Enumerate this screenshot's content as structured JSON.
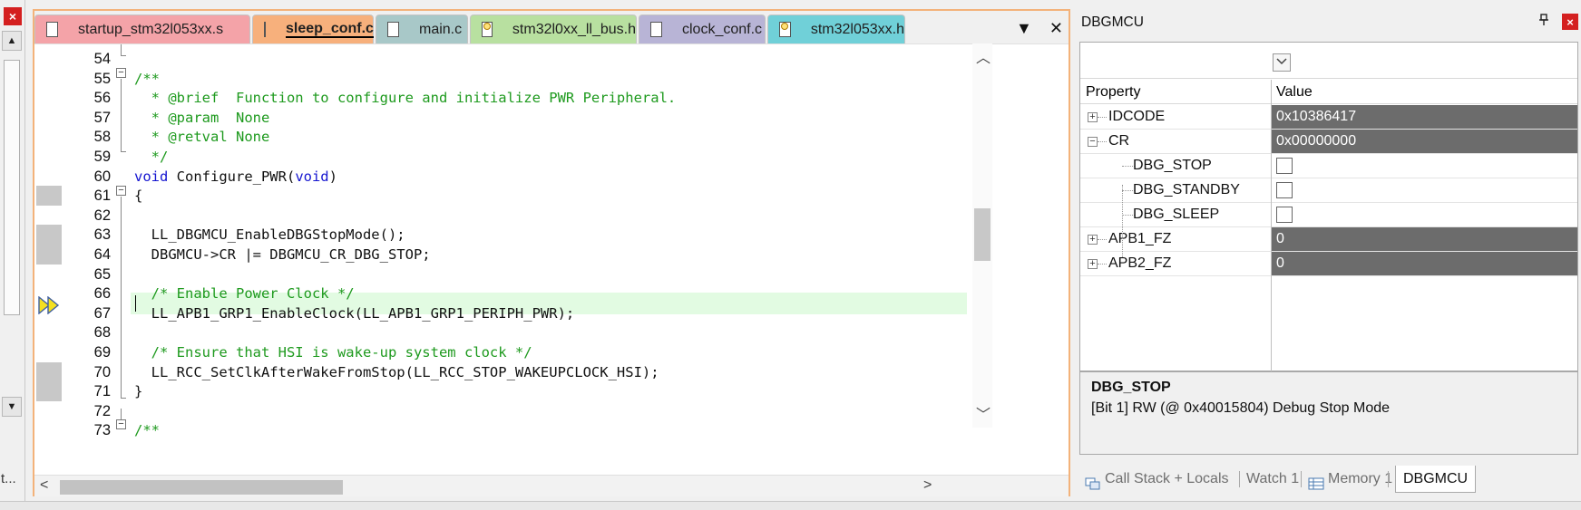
{
  "left_panel": {
    "close_glyph": "×",
    "up_arrow": "▲",
    "down_arrow": "▼",
    "truncated_label": "t..."
  },
  "editor": {
    "tabs": [
      {
        "label": "startup_stm32l053xx.s",
        "color": "#f4a3a8",
        "icon": "file-icon",
        "active": false
      },
      {
        "label": "sleep_conf.c",
        "color": "#f7b07c",
        "icon": "file-icon",
        "active": true
      },
      {
        "label": "main.c",
        "color": "#a8c8c8",
        "icon": "file-icon",
        "active": false
      },
      {
        "label": "stm32l0xx_ll_bus.h",
        "color": "#b8e0a0",
        "icon": "key-file-icon",
        "active": false
      },
      {
        "label": "clock_conf.c",
        "color": "#b8b4d6",
        "icon": "file-icon",
        "active": false
      },
      {
        "label": "stm32l053xx.h",
        "color": "#70d0d8",
        "icon": "key-file-icon",
        "active": false
      }
    ],
    "tab_menu_glyph": "▼",
    "tab_close_glyph": "✕",
    "current_line": 67,
    "lines": [
      {
        "num": "54",
        "text": "",
        "cls": "c-id"
      },
      {
        "num": "55",
        "text": "/**",
        "cls": "c-comment"
      },
      {
        "num": "56",
        "text": "  * @brief  Function to configure and initialize PWR Peripheral.",
        "cls": "c-comment"
      },
      {
        "num": "57",
        "text": "  * @param  None",
        "cls": "c-comment"
      },
      {
        "num": "58",
        "text": "  * @retval None",
        "cls": "c-comment"
      },
      {
        "num": "59",
        "text": "  */",
        "cls": "c-comment"
      },
      {
        "num": "60",
        "text": "",
        "cls": "c-id",
        "parts": [
          {
            "t": "void",
            "c": "c-kw"
          },
          {
            "t": " Configure_PWR(",
            "c": "c-id"
          },
          {
            "t": "void",
            "c": "c-kw"
          },
          {
            "t": ")",
            "c": "c-id"
          }
        ]
      },
      {
        "num": "61",
        "text": "{",
        "cls": "c-id"
      },
      {
        "num": "62",
        "text": "",
        "cls": "c-id"
      },
      {
        "num": "63",
        "text": "  LL_DBGMCU_EnableDBGStopMode();",
        "cls": "c-id"
      },
      {
        "num": "64",
        "text": "  DBGMCU->CR |= DBGMCU_CR_DBG_STOP;",
        "cls": "c-id"
      },
      {
        "num": "65",
        "text": "",
        "cls": "c-id"
      },
      {
        "num": "66",
        "text": "  /* Enable Power Clock */",
        "cls": "c-comment"
      },
      {
        "num": "67",
        "text": "  LL_APB1_GRP1_EnableClock(LL_APB1_GRP1_PERIPH_PWR);",
        "cls": "c-id"
      },
      {
        "num": "68",
        "text": "",
        "cls": "c-id"
      },
      {
        "num": "69",
        "text": "  /* Ensure that HSI is wake-up system clock */",
        "cls": "c-comment"
      },
      {
        "num": "70",
        "text": "  LL_RCC_SetClkAfterWakeFromStop(LL_RCC_STOP_WAKEUPCLOCK_HSI);",
        "cls": "c-id"
      },
      {
        "num": "71",
        "text": "}",
        "cls": "c-id"
      },
      {
        "num": "72",
        "text": "",
        "cls": "c-id"
      },
      {
        "num": "73",
        "text": "/**",
        "cls": "c-comment"
      }
    ],
    "breakpoint_lines": [
      "61",
      "63",
      "64",
      "70",
      "71"
    ]
  },
  "panel": {
    "title": "DBGMCU",
    "pin_glyph": "📌",
    "close_glyph": "×",
    "dropdown_glyph": "⌄",
    "header": {
      "property": "Property",
      "value": "Value"
    },
    "rows": [
      {
        "name": "IDCODE",
        "value": "0x10386417",
        "type": "expandable",
        "expanded": false
      },
      {
        "name": "CR",
        "value": "0x00000000",
        "type": "expandable",
        "expanded": true
      },
      {
        "name": "DBG_STOP",
        "value": "",
        "type": "checkbox",
        "checked": false
      },
      {
        "name": "DBG_STANDBY",
        "value": "",
        "type": "checkbox",
        "checked": false
      },
      {
        "name": "DBG_SLEEP",
        "value": "",
        "type": "checkbox",
        "checked": false
      },
      {
        "name": "APB1_FZ",
        "value": "0",
        "type": "expandable",
        "expanded": false
      },
      {
        "name": "APB2_FZ",
        "value": "0",
        "type": "expandable",
        "expanded": false
      }
    ],
    "description": {
      "title": "DBG_STOP",
      "text": "[Bit 1] RW (@ 0x40015804) Debug Stop Mode"
    },
    "bottom_tabs": [
      {
        "label": "Call Stack + Locals",
        "icon": "call-stack-icon",
        "active": false
      },
      {
        "label": "Watch 1",
        "icon": "",
        "active": false
      },
      {
        "label": "Memory 1",
        "icon": "memory-icon",
        "active": false
      },
      {
        "label": "DBGMCU",
        "icon": "",
        "active": true
      }
    ]
  },
  "colors": {
    "editor_border": "#f3b27a",
    "current_line_bg": "#e2fbe2",
    "value_cell_bg": "#6c6c6c",
    "comment": "#1e9a1e",
    "keyword": "#1515d0"
  }
}
